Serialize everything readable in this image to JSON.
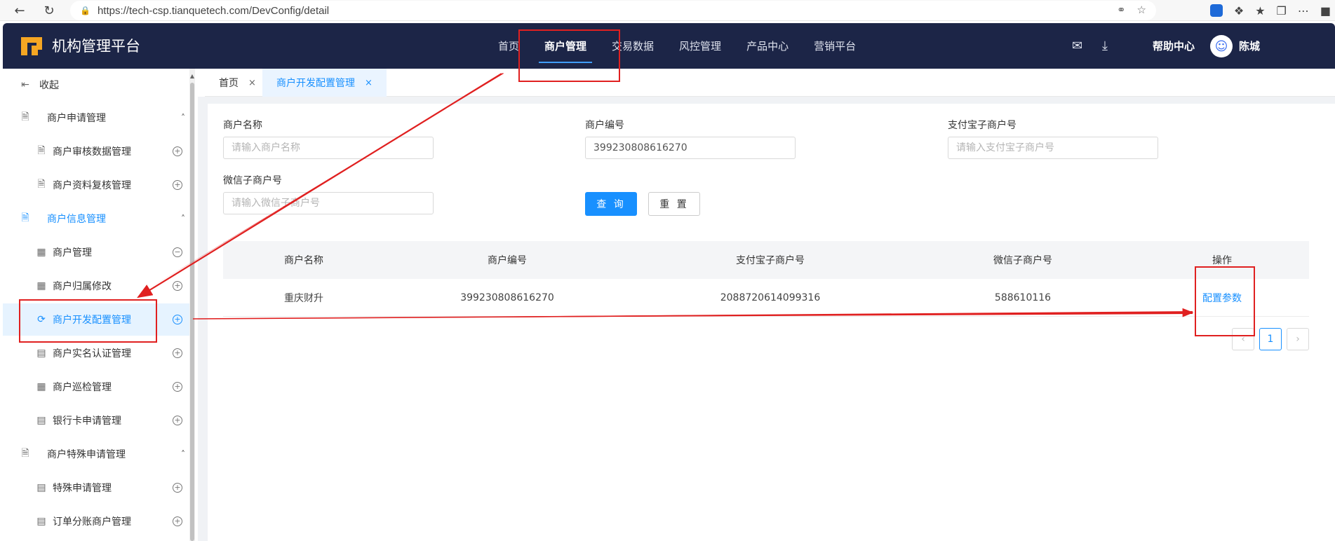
{
  "browser": {
    "url": "https://tech-csp.tianquetech.com/DevConfig/detail",
    "nav_icons": [
      "back-icon",
      "refresh-icon"
    ],
    "toolbar_icons": [
      "read-aloud-icon",
      "favorite-icon",
      "copilot-icon",
      "extensions-icon",
      "favorites-list-icon",
      "collections-icon",
      "more-icon"
    ]
  },
  "header": {
    "title": "机构管理平台",
    "nav": [
      "首页",
      "商户管理",
      "交易数据",
      "风控管理",
      "产品中心",
      "营销平台"
    ],
    "active_nav": "商户管理",
    "help": "帮助中心",
    "user": "陈城"
  },
  "sidebar": {
    "collapse": "收起",
    "group1": "商户申请管理",
    "g1_items": [
      "商户审核数据管理",
      "商户资料复核管理"
    ],
    "group2": "商户信息管理",
    "g2_items": [
      "商户管理",
      "商户归属修改",
      "商户开发配置管理",
      "商户实名认证管理",
      "商户巡检管理",
      "银行卡申请管理"
    ],
    "group3": "商户特殊申请管理",
    "g3_items": [
      "特殊申请管理",
      "订单分账商户管理"
    ]
  },
  "tabs": [
    "首页",
    "商户开发配置管理"
  ],
  "form": {
    "name_label": "商户名称",
    "name_placeholder": "请输入商户名称",
    "no_label": "商户编号",
    "no_value": "399230808616270",
    "alipay_label": "支付宝子商户号",
    "alipay_placeholder": "请输入支付宝子商户号",
    "wechat_label": "微信子商户号",
    "wechat_placeholder": "请输入微信子商户号",
    "query": "查 询",
    "reset": "重 置"
  },
  "table": {
    "headers": [
      "商户名称",
      "商户编号",
      "支付宝子商户号",
      "微信子商户号",
      "操作"
    ],
    "rows": [
      [
        "重庆财升",
        "399230808616270",
        "2088720614099316",
        "588610116",
        "配置参数"
      ]
    ]
  },
  "pagination": {
    "current": "1"
  },
  "colors": {
    "header_bg": "#1c2547",
    "accent": "#1890ff",
    "annotation": "#e02020",
    "logo": "#f5a623"
  }
}
